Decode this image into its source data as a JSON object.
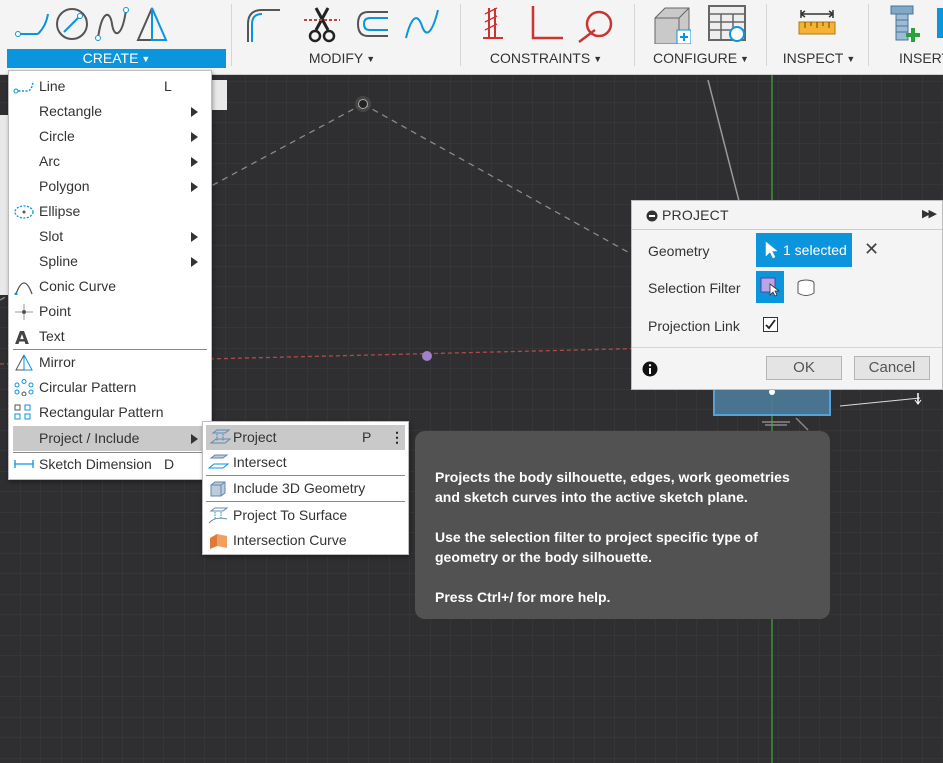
{
  "toolbar": {
    "groups": [
      {
        "label": "CREATE"
      },
      {
        "label": "MODIFY"
      },
      {
        "label": "CONSTRAINTS"
      },
      {
        "label": "CONFIGURE"
      },
      {
        "label": "INSPECT"
      },
      {
        "label": "INSERT"
      }
    ]
  },
  "create_menu": {
    "items": [
      {
        "label": "Line",
        "shortcut": "L",
        "icon": "line-icon"
      },
      {
        "label": "Rectangle",
        "icon": "",
        "submenu": true
      },
      {
        "label": "Circle",
        "icon": "",
        "submenu": true
      },
      {
        "label": "Arc",
        "icon": "",
        "submenu": true
      },
      {
        "label": "Polygon",
        "icon": "",
        "submenu": true
      },
      {
        "label": "Ellipse",
        "icon": "ellipse-icon"
      },
      {
        "label": "Slot",
        "icon": "",
        "submenu": true
      },
      {
        "label": "Spline",
        "icon": "",
        "submenu": true
      },
      {
        "label": "Conic Curve",
        "icon": "conic-curve-icon"
      },
      {
        "label": "Point",
        "icon": "point-icon"
      },
      {
        "label": "Text",
        "icon": "text-icon"
      },
      {
        "label": "Mirror",
        "icon": "mirror-icon"
      },
      {
        "label": "Circular Pattern",
        "icon": "circular-pattern-icon"
      },
      {
        "label": "Rectangular Pattern",
        "icon": "rectangular-pattern-icon"
      },
      {
        "label": "Project / Include",
        "icon": "",
        "submenu": true,
        "highlighted": true
      },
      {
        "label": "Sketch Dimension",
        "shortcut": "D",
        "icon": "sketch-dimension-icon"
      }
    ]
  },
  "project_submenu": {
    "items": [
      {
        "label": "Project",
        "shortcut": "P",
        "icon": "project-icon",
        "highlighted": true
      },
      {
        "label": "Intersect",
        "icon": "intersect-icon"
      },
      {
        "label": "Include 3D Geometry",
        "icon": "include-3d-geometry-icon"
      },
      {
        "label": "Project To Surface",
        "icon": "project-to-surface-icon"
      },
      {
        "label": "Intersection Curve",
        "icon": "intersection-curve-icon"
      }
    ]
  },
  "tooltip": {
    "para1": "Projects the body silhouette, edges, work geometries and sketch curves into the active sketch plane.",
    "para2": "Use the selection filter to project specific type of geometry or the body silhouette.",
    "para3": "Press Ctrl+/ for more help."
  },
  "dialog": {
    "title": "PROJECT",
    "geometry_label": "Geometry",
    "geometry_value": "1 selected",
    "selection_filter_label": "Selection Filter",
    "projection_link_label": "Projection Link",
    "projection_link_checked": true,
    "ok_label": "OK",
    "cancel_label": "Cancel"
  },
  "colors": {
    "accent": "#0b95dd",
    "canvas": "#2f2f31",
    "grid": "#3d3d40",
    "x_axis": "#b04a4a",
    "y_axis": "#3f8f3f",
    "tooltip_bg": "#525252"
  }
}
